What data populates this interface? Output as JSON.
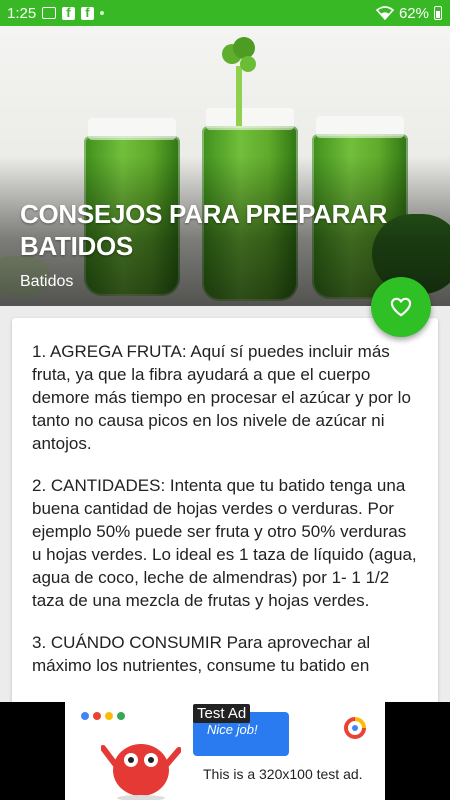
{
  "status_bar": {
    "time": "1:25",
    "battery_percent": "62%",
    "icons": [
      "image-icon",
      "facebook-icon",
      "facebook-icon",
      "dot-icon",
      "wifi-icon",
      "battery-icon"
    ]
  },
  "hero": {
    "title": "CONSEJOS PARA PREPARAR BATIDOS",
    "category": "Batidos"
  },
  "fab": {
    "icon": "heart-icon"
  },
  "article": {
    "paragraphs": [
      "1. AGREGA FRUTA: Aquí sí puedes incluir más fruta, ya que la fibra ayudará a que el cuerpo demore más tiempo en procesar el azúcar y por lo tanto no causa picos en los nivele de azúcar ni antojos.",
      "2. CANTIDADES: Intenta que tu batido tenga una buena cantidad de hojas verdes o verduras. Por ejemplo 50% puede ser fruta y otro 50% verduras u hojas verdes. Lo ideal es 1 taza de líquido (agua, agua de coco, leche de almendras) por 1- 1 1/2 taza de una mezcla de frutas y hojas verdes.",
      "3. CUÁNDO CONSUMIR Para aprovechar al máximo los nutrientes, consume tu batido en"
    ]
  },
  "ad": {
    "label": "Test Ad",
    "bubble_text": "Nice job!",
    "text": "This is a 320x100 test ad."
  },
  "colors": {
    "status_bar": "#37b824",
    "fab": "#2ec024"
  }
}
